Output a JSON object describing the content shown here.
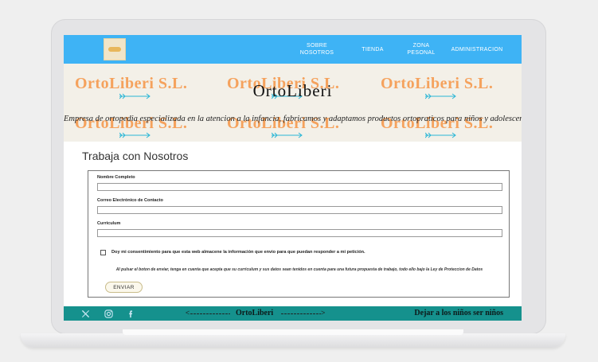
{
  "navbar": {
    "items": [
      {
        "line1": "SOBRE",
        "line2": "NOSOTROS"
      },
      {
        "line1": "TIENDA",
        "line2": ""
      },
      {
        "line1": "ZONA",
        "line2": "PESONAL"
      },
      {
        "line1": "ADMINISTRACION",
        "line2": ""
      }
    ]
  },
  "hero": {
    "watermark_text": "OrtoLiberi S.L.",
    "title": "OrtoLiberi",
    "subtitle": "Empresa de ortopedia especializada en la atencion a la infancia, fabricamos y adaptamos productos ortopraticos para niños y adolescentes"
  },
  "main": {
    "heading": "Trabaja con Nosotros"
  },
  "form": {
    "fields": [
      {
        "label": "Nombre Completo",
        "value": ""
      },
      {
        "label": "Correo Electrónico de Contacto",
        "value": ""
      },
      {
        "label": "Curriculum",
        "value": ""
      }
    ],
    "consent_label": "Doy mi consentimiento para que esta web almacene la información que envio para que puedan responder a mi petición.",
    "consent_checked": false,
    "legal_notice": "Al pulsar el boton de enviar, tenga en cuenta que acepta que su curriculum y sus datos sean tenidos en cuenta para una futura propuesta de trabajo, todo ello bajo la Ley de Proteccion de Datos",
    "submit_label": "ENVIAR"
  },
  "footer": {
    "social_icons": [
      "x-icon",
      "instagram-icon",
      "facebook-icon"
    ],
    "brand": "OrtoLiberi",
    "slogan": "Dejar a los niños ser niños"
  },
  "colors": {
    "navbar": "#3eb3f5",
    "hero_bg": "#f3f0e8",
    "watermark": "#f5a25d",
    "arrow": "#2ab6d6",
    "footer": "#15918d"
  }
}
